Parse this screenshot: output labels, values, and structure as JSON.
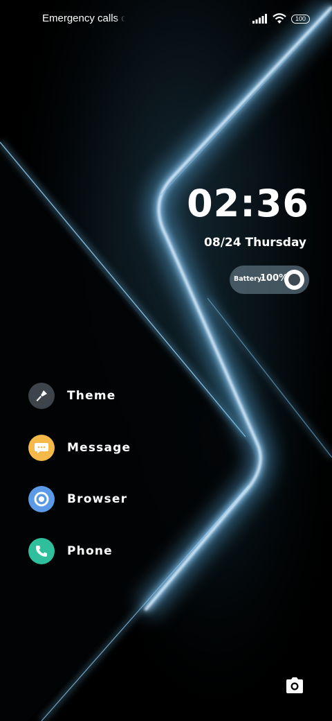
{
  "status_bar": {
    "carrier_text": "Emergency calls only",
    "battery_level": "100",
    "icons": [
      "signal-icon",
      "wifi-icon",
      "battery-icon"
    ]
  },
  "lockscreen": {
    "time": "02:36",
    "date": "08/24 Thursday"
  },
  "battery_widget": {
    "label": "Battery:",
    "value": "100%",
    "level": 1.0
  },
  "shortcuts": [
    {
      "label": "Theme",
      "icon": "brush-icon",
      "color": "#3d444b"
    },
    {
      "label": "Message",
      "icon": "message-icon",
      "color": "#f5b94a"
    },
    {
      "label": "Browser",
      "icon": "browser-icon",
      "color": "#5b9ae6"
    },
    {
      "label": "Phone",
      "icon": "phone-icon",
      "color": "#2fbf9c"
    }
  ],
  "camera": {
    "icon": "camera-icon"
  },
  "colors": {
    "background": "#000000",
    "accent_glow": "#9fd4ff"
  }
}
